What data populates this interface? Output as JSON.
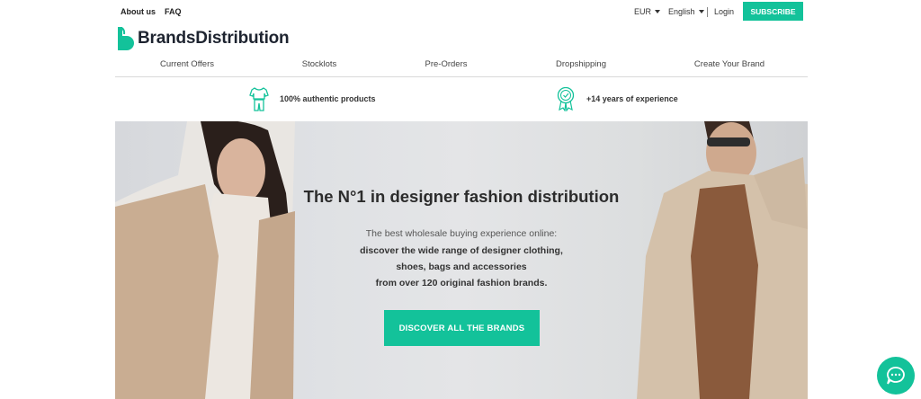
{
  "topbar": {
    "about": "About us",
    "faq": "FAQ",
    "currency": "EUR",
    "language": "English",
    "login": "Login",
    "subscribe": "SUBSCRIBE"
  },
  "logo": {
    "text": "BrandsDistribution",
    "icon": "brand-b-icon"
  },
  "nav": [
    "Current Offers",
    "Stocklots",
    "Pre-Orders",
    "Dropshipping",
    "Create Your Brand"
  ],
  "features": [
    {
      "icon": "clothes-icon",
      "text": "100% authentic products"
    },
    {
      "icon": "award-badge-icon",
      "text": "+14 years of experience"
    }
  ],
  "hero": {
    "title": "The N°1 in designer fashion distribution",
    "line1": "The best wholesale buying experience online:",
    "line2": "discover the wide range of designer clothing,",
    "line3": "shoes, bags and accessories",
    "line4": "from over 120 original fashion brands.",
    "cta": "DISCOVER ALL THE BRANDS"
  },
  "chat": {
    "icon": "chat-bubble-icon"
  },
  "colors": {
    "accent": "#13c29a",
    "text": "#2b2b2b"
  }
}
